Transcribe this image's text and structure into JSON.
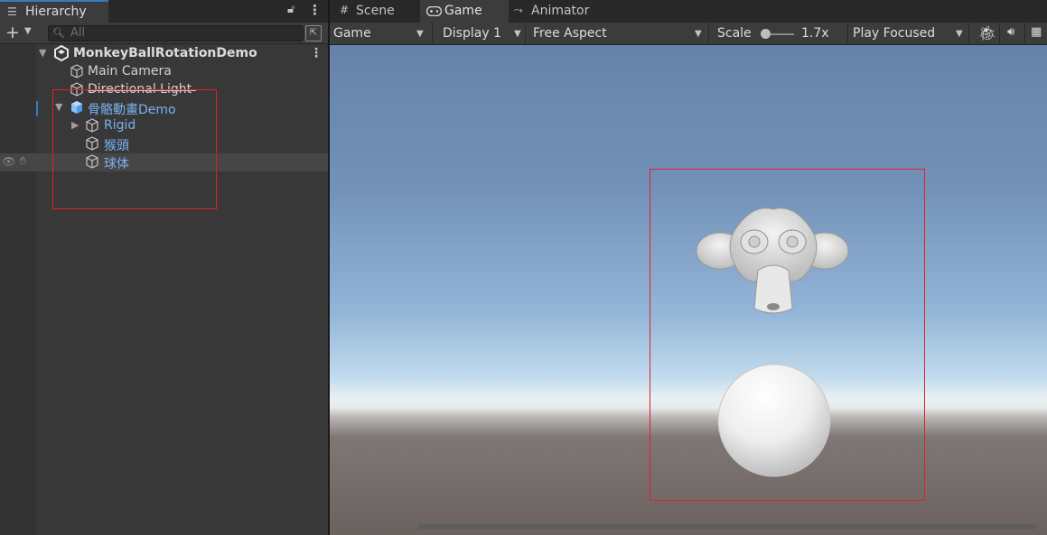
{
  "hierarchy": {
    "tab_label": "Hierarchy",
    "search_placeholder": "All",
    "scene_name": "MonkeyBallRotationDemo",
    "items": [
      {
        "label": "Main Camera"
      },
      {
        "label": "Directional Light"
      },
      {
        "label": "骨骼動畫Demo"
      },
      {
        "label": "Rigid"
      },
      {
        "label": "猴頭"
      },
      {
        "label": "球体"
      }
    ]
  },
  "game_panel": {
    "tabs": [
      {
        "label": "Scene",
        "icon": "grid-icon"
      },
      {
        "label": "Game",
        "icon": "gamepad-icon"
      },
      {
        "label": "Animator",
        "icon": "animator-icon"
      }
    ],
    "toolbar": {
      "mode": "Game",
      "display": "Display 1",
      "aspect": "Free Aspect",
      "scale_label": "Scale",
      "scale_value": "1.7x",
      "play_mode": "Play Focused"
    }
  },
  "colors": {
    "selection_blue": "#7ab2f0",
    "annotation_red": "#e0202a",
    "panel_bg": "#383838"
  }
}
